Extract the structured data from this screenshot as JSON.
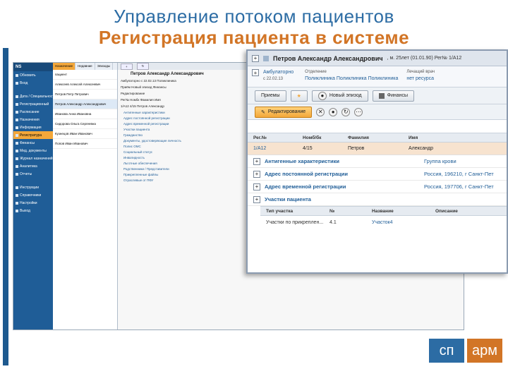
{
  "slide": {
    "title": "Управление потоком пациентов",
    "subtitle": "Регистрация пациента в системе"
  },
  "colors": {
    "title_blue": "#2c6ca4",
    "subtitle_orange": "#d27526",
    "sidebar_blue": "#1f5d97",
    "accent_orange": "#f3a73a"
  },
  "app": {
    "logo_label": "NS",
    "sidebar_items": [
      "Обновить",
      "Вход",
      "Дата / Специальность",
      "Регистрационный",
      "Расписание",
      "Назначения",
      "Информация",
      "Регистратура",
      "Финансы",
      "Мед. документы",
      "Журнал назначений",
      "Аналитика",
      "Отчеты",
      "Инструкции",
      "Справочники",
      "Настройки",
      "Выход"
    ],
    "list_tabs": [
      "Назначение",
      "Недавние",
      "Эпизоды"
    ],
    "list_items": [
      "пациент",
      "Алексеев Алексей Алексеевич",
      "Петров Петр Петрович",
      "Петров Александр Александрович",
      "Иванова Анна Ивановна",
      "Сидорова Ольга Сергеевна",
      "Кузнецов Иван Иванович",
      "Попов Иван Иванович"
    ],
    "main_patient": "Петров Александр Александрович",
    "main_rows": [
      "Амбулаторно  с 22.02.13   Поликлиника",
      "Приём   Новый эпизод   Финансы",
      "Редактирование",
      "Рег№   Номбк   Фамилия   Имя",
      "1/А12   4/15   Петров   Александр"
    ],
    "main_sections": [
      "Антигенные характеристики",
      "Адрес постоянной регистрации",
      "Адрес временной регистрации",
      "Участки пациента",
      "Гражданство",
      "Документы, удостоверяющие личность",
      "Полис ОМС",
      "Социальный статус",
      "Инвалидность",
      "Льготные обеспечения",
      "Родственники / Представители",
      "Прикрепленные файлы",
      "Отраслевые от ПФУ"
    ]
  },
  "zoom": {
    "patient_name": "Петров Александр Александрович",
    "patient_info": ", м. 25лет (01.01.90) Рег№ 1/А12",
    "episode_type": "Амбулаторно",
    "episode_date": "с 22.02.13",
    "dept_label": "Отделение",
    "dept_value": "Поликлиника Поликлиника Поликлиника",
    "doctor_label": "Лечащий врач",
    "doctor_value": "нет ресурса",
    "btn_receptions": "Приемы",
    "btn_new_episode": "Новый эпизод",
    "btn_finance": "Финансы",
    "btn_edit": "Редактирование",
    "table_headers": [
      "Рег.№",
      "Номб/бк",
      "Фамилия",
      "Имя"
    ],
    "table_row": [
      "1/А12",
      "4/15",
      "Петров",
      "Александр"
    ],
    "sections": [
      {
        "label": "Антигенные характеристики",
        "value": "Группа крови"
      },
      {
        "label": "Адрес постоянной регистрации",
        "value": "Россия, 196210, г Санкт-Пет"
      },
      {
        "label": "Адрес временной регистрации",
        "value": "Россия, 197706, г Санкт-Пет"
      },
      {
        "label": "Участки пациента",
        "value": ""
      }
    ],
    "sub_headers": [
      "Тип участка",
      "№",
      "Название",
      "Описание"
    ],
    "sub_row": [
      "Участки по прикреплен...",
      "4.1",
      "Участок4",
      ""
    ]
  },
  "logo": {
    "part1": "сп",
    "part2": "арм"
  }
}
